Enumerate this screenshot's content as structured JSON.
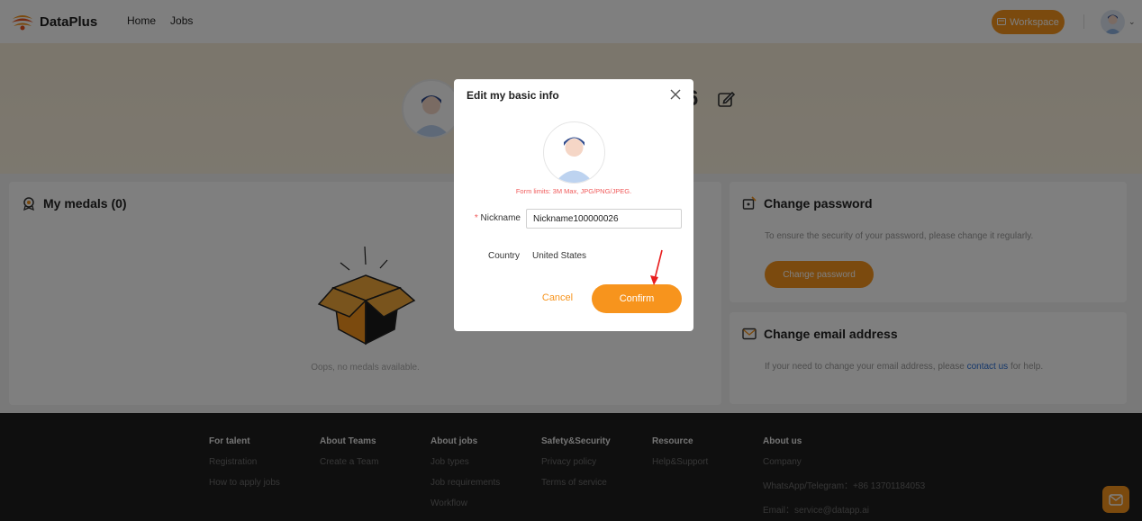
{
  "header": {
    "brand": "DataPlus",
    "nav": [
      "Home",
      "Jobs"
    ],
    "workspace_label": "Workspace"
  },
  "profile": {
    "name_tail": "6"
  },
  "medals": {
    "title": "My medals (0)",
    "empty_text": "Oops, no medals available."
  },
  "password_card": {
    "title": "Change password",
    "description": "To ensure the security of your password, please change it regularly.",
    "button_label": "Change password"
  },
  "email_card": {
    "title": "Change email address",
    "description_before": "If your need to change your email address, please ",
    "link_text": "contact us",
    "description_after": " for help."
  },
  "footer": {
    "columns": [
      {
        "heading": "For talent",
        "items": [
          "Registration",
          "How to apply jobs"
        ]
      },
      {
        "heading": "About Teams",
        "items": [
          "Create a Team"
        ]
      },
      {
        "heading": "About jobs",
        "items": [
          "Job types",
          "Job requirements",
          "Workflow"
        ]
      },
      {
        "heading": "Safety&Security",
        "items": [
          "Privacy policy",
          "Terms of service"
        ]
      },
      {
        "heading": "Resource",
        "items": [
          "Help&Support"
        ]
      },
      {
        "heading": "About us",
        "items": [
          "Company",
          "WhatsApp/Telegram：+86 13701184053",
          "Email：service@datapp.ai"
        ]
      }
    ]
  },
  "modal": {
    "title": "Edit my basic info",
    "form_limits": "Form limits: 3M Max, JPG/PNG/JPEG.",
    "nickname_label": "Nickname",
    "nickname_required_mark": "*",
    "nickname_value": "Nickname100000026",
    "country_label": "Country",
    "country_value": "United States",
    "cancel_label": "Cancel",
    "confirm_label": "Confirm"
  },
  "colors": {
    "accent": "#f7941d",
    "overlay": "rgba(0,0,0,0.5)",
    "link": "#2b6fd6",
    "required": "#f05a5a"
  }
}
